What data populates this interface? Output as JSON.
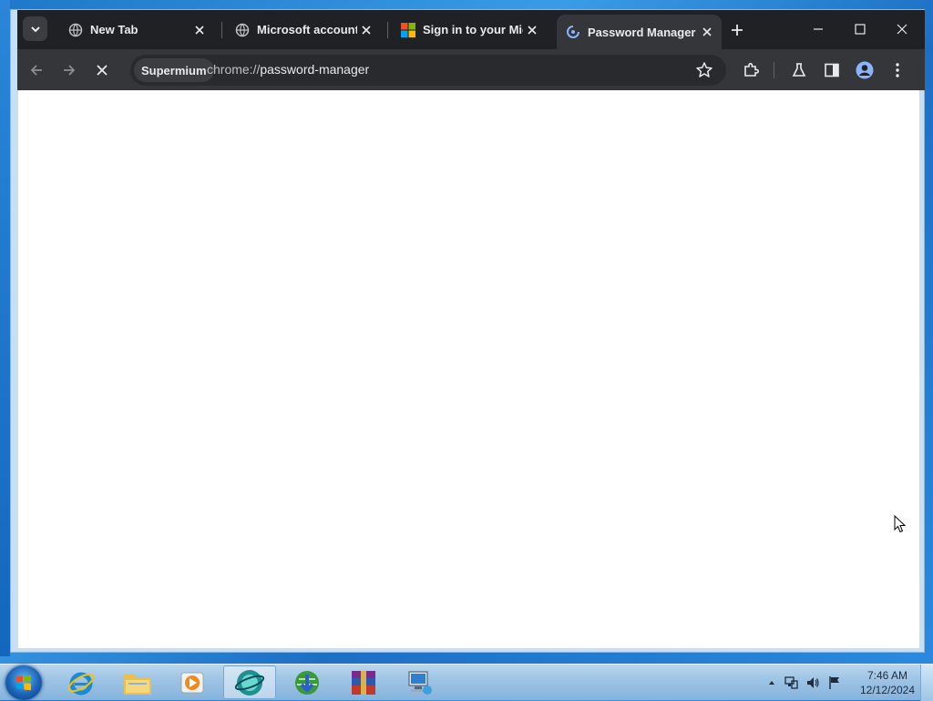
{
  "browser": {
    "tabs": [
      {
        "title": "New Tab",
        "favicon": "globe-icon",
        "active": false
      },
      {
        "title": "Microsoft account",
        "favicon": "globe-icon",
        "active": false
      },
      {
        "title": "Sign in to your Micro",
        "favicon": "microsoft-logo-icon",
        "active": false
      },
      {
        "title": "Password Manager",
        "favicon": "loading-key-icon",
        "active": true
      }
    ],
    "omnibox": {
      "chip_label": "Supermium",
      "scheme": "chrome://",
      "path": "password-manager"
    },
    "colors": {
      "tabstrip": "#202124",
      "toolbar": "#35363a",
      "accent": "#8ab4f8"
    }
  },
  "taskbar": {
    "apps": [
      "internet-explorer-icon",
      "file-explorer-icon",
      "media-player-icon",
      "supermium-browser-icon",
      "download-manager-icon",
      "winrar-icon",
      "network-computer-icon"
    ],
    "clock": {
      "time": "7:46 AM",
      "date": "12/12/2024"
    }
  }
}
